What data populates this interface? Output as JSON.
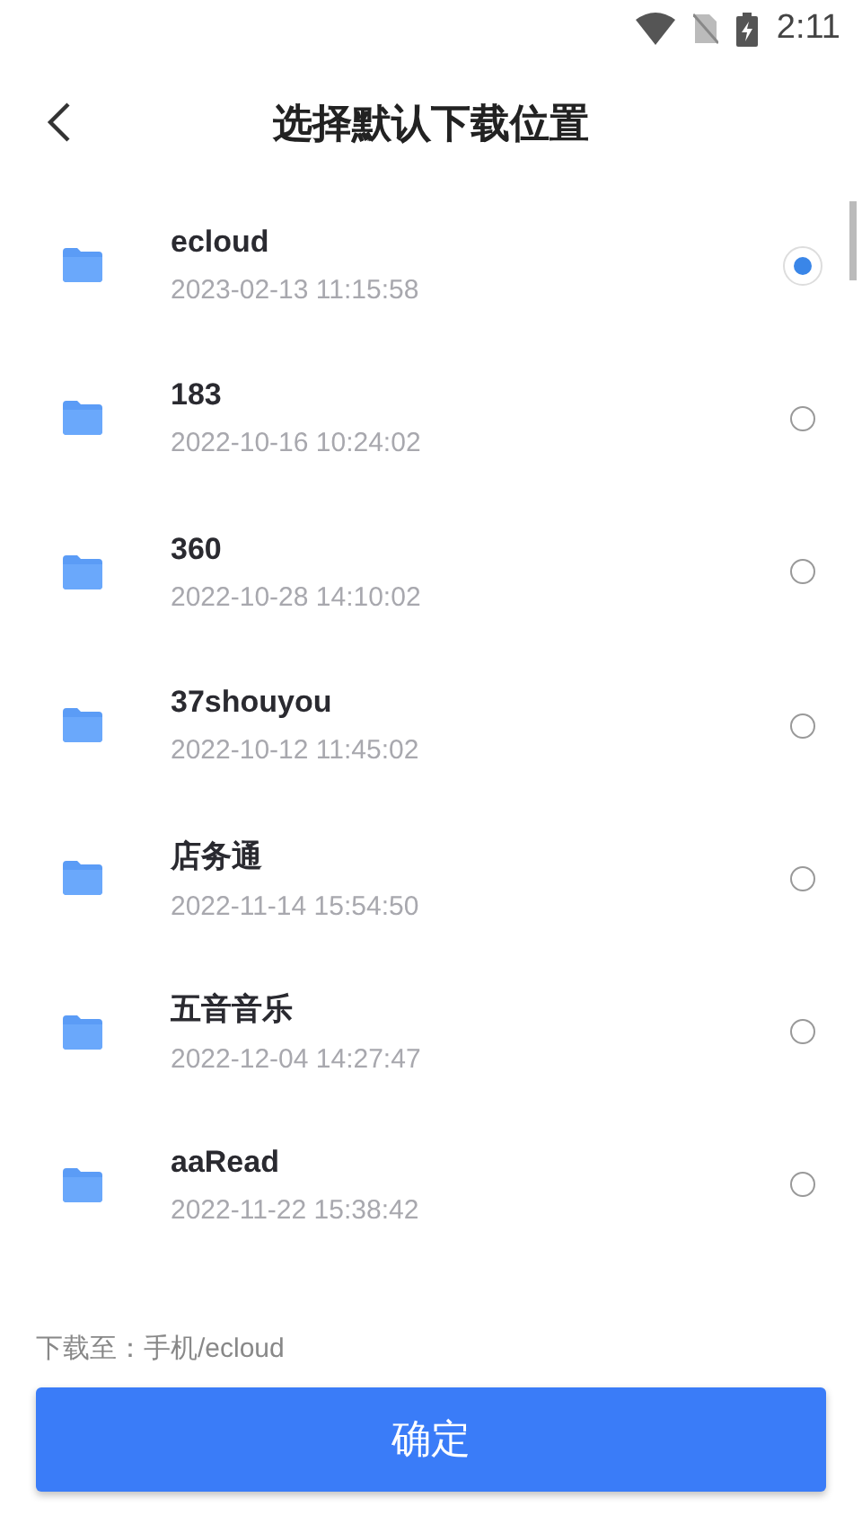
{
  "status_bar": {
    "time": "2:11"
  },
  "header": {
    "title": "选择默认下载位置"
  },
  "folders": [
    {
      "name": "ecloud",
      "date": "2023-02-13 11:15:58",
      "selected": true
    },
    {
      "name": "183",
      "date": "2022-10-16 10:24:02",
      "selected": false
    },
    {
      "name": "360",
      "date": "2022-10-28 14:10:02",
      "selected": false
    },
    {
      "name": "37shouyou",
      "date": "2022-10-12 11:45:02",
      "selected": false
    },
    {
      "name": "店务通",
      "date": "2022-11-14 15:54:50",
      "selected": false
    },
    {
      "name": "五音音乐",
      "date": "2022-12-04 14:27:47",
      "selected": false
    },
    {
      "name": "aaRead",
      "date": "2022-11-22 15:38:42",
      "selected": false
    }
  ],
  "footer": {
    "path": "下载至：手机/ecloud",
    "confirm": "确定"
  }
}
